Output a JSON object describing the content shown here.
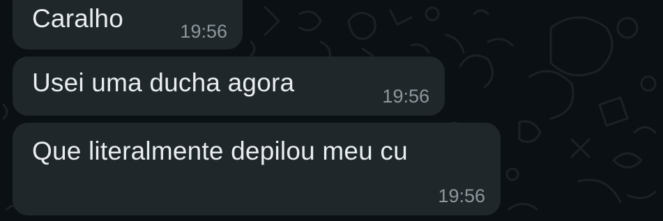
{
  "chat": {
    "background_color": "#0b1014",
    "bubble_color": "#1f272a",
    "text_color": "#e9edef",
    "time_color": "#8d979d",
    "messages": [
      {
        "text": "Caralho",
        "time": "19:56"
      },
      {
        "text": "Usei uma ducha agora",
        "time": "19:56"
      },
      {
        "text": "Que literalmente depilou meu cu",
        "time": "19:56"
      }
    ]
  }
}
